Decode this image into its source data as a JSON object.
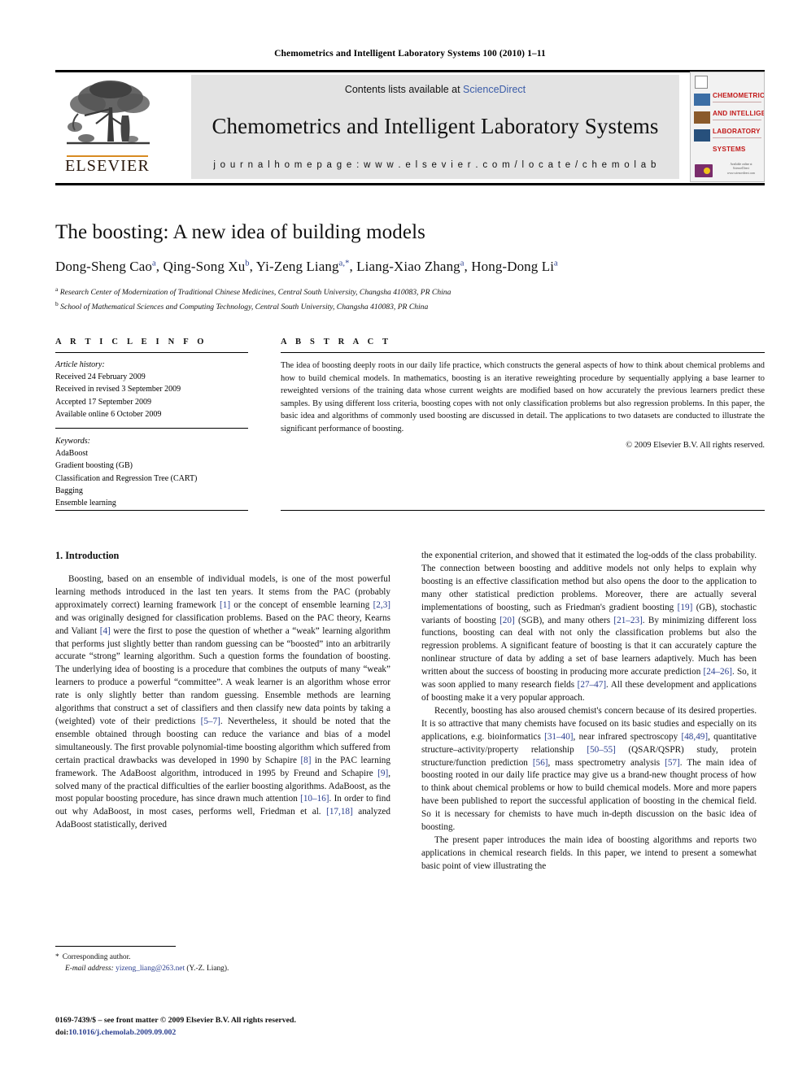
{
  "running_head": "Chemometrics and Intelligent Laboratory Systems 100 (2010) 1–11",
  "masthead": {
    "publisher_name": "ELSEVIER",
    "contents_prefix": "Contents lists available at ",
    "sciencedirect": "ScienceDirect",
    "journal_title": "Chemometrics and Intelligent Laboratory Systems",
    "homepage_label": "j o u r n a l   h o m e p a g e :   w w w . e l s e v i e r . c o m / l o c a t e / c h e m o l a b",
    "cover": {
      "line1": "CHEMOMETRICS",
      "line2": "AND INTELLIGENT",
      "line3": "LABORATORY",
      "line4": "SYSTEMS",
      "footer1": "Available online at",
      "footer2": "ScienceDirect",
      "footer3": "www.sciencedirect.com"
    }
  },
  "article": {
    "title": "The boosting: A new idea of building models",
    "authors_html": "Dong-Sheng Cao, Qing-Song Xu, Yi-Zeng Liang, Liang-Xiao Zhang, Hong-Dong Li",
    "affiliation_a": "Research Center of Modernization of Traditional Chinese Medicines, Central South University, Changsha 410083, PR China",
    "affiliation_b": "School of Mathematical Sciences and Computing Technology, Central South University, Changsha 410083, PR China"
  },
  "info": {
    "heading": "A R T I C L E   I N F O",
    "history_label": "Article history:",
    "history": [
      "Received 24 February 2009",
      "Received in revised 3 September 2009",
      "Accepted 17 September 2009",
      "Available online 6 October 2009"
    ],
    "keywords_label": "Keywords:",
    "keywords": [
      "AdaBoost",
      "Gradient boosting (GB)",
      "Classification and Regression Tree (CART)",
      "Bagging",
      "Ensemble learning"
    ]
  },
  "abstract": {
    "heading": "A B S T R A C T",
    "text": "The idea of boosting deeply roots in our daily life practice, which constructs the general aspects of how to think about chemical problems and how to build chemical models. In mathematics, boosting is an iterative reweighting procedure by sequentially applying a base learner to reweighted versions of the training data whose current weights are modified based on how accurately the previous learners predict these samples. By using different loss criteria, boosting copes with not only classification problems but also regression problems. In this paper, the basic idea and algorithms of commonly used boosting are discussed in detail. The applications to two datasets are conducted to illustrate the significant performance of boosting.",
    "copyright": "© 2009 Elsevier B.V. All rights reserved."
  },
  "body": {
    "section_title": "1. Introduction",
    "left_paragraph_1_part1": "Boosting, based on an ensemble of individual models, is one of the most powerful learning methods introduced in the last ten years. It stems from the PAC (probably approximately correct) learning framework ",
    "ref1": "[1]",
    "left_paragraph_1_part2": " or the concept of ensemble learning ",
    "ref23": "[2,3]",
    "left_paragraph_1_part3": " and was originally designed for classification problems. Based on the PAC theory, Kearns and Valiant ",
    "ref4": "[4]",
    "left_paragraph_1_part4": " were the first to pose the question of whether a “weak” learning algorithm that performs just slightly better than random guessing can be “boosted” into an arbitrarily accurate “strong” learning algorithm. Such a question forms the foundation of boosting. The underlying idea of boosting is a procedure that combines the outputs of many “weak” learners to produce a powerful “committee”. A weak learner is an algorithm whose error rate is only slightly better than random guessing. Ensemble methods are learning algorithms that construct a set of classifiers and then classify new data points by taking a (weighted) vote of their predictions ",
    "ref57": "[5–7]",
    "left_paragraph_1_part5": ". Nevertheless, it should be noted that the ensemble obtained through boosting can reduce the variance and bias of a model simultaneously. The first provable polynomial-time boosting algorithm which suffered from certain practical drawbacks was developed in 1990 by Schapire ",
    "ref8": "[8]",
    "left_paragraph_1_part6": " in the PAC learning framework. The AdaBoost algorithm, introduced in 1995 by Freund and Schapire ",
    "ref9": "[9]",
    "left_paragraph_1_part7": ", solved many of the practical difficulties of the earlier boosting algorithms. AdaBoost, as the most popular boosting procedure, has since drawn much attention ",
    "ref1016": "[10–16]",
    "left_paragraph_1_part8": ". In order to find out why AdaBoost, in most cases, performs well, Friedman et al. ",
    "ref1718": "[17,18]",
    "left_paragraph_1_part9": " analyzed AdaBoost statistically, derived ",
    "right_paragraph_1_part1": "the exponential criterion, and showed that it estimated the log-odds of the class probability. The connection between boosting and additive models not only helps to explain why boosting is an effective classification method but also opens the door to the application to many other statistical prediction problems. Moreover, there are actually several implementations of boosting, such as Friedman's gradient boosting ",
    "ref19": "[19]",
    "right_paragraph_1_part2": " (GB), stochastic variants of boosting ",
    "ref20": "[20]",
    "right_paragraph_1_part3": " (SGB), and many others ",
    "ref2123": "[21–23]",
    "right_paragraph_1_part4": ". By minimizing different loss functions, boosting can deal with not only the classification problems but also the regression problems. A significant feature of boosting is that it can accurately capture the nonlinear structure of data by adding a set of base learners adaptively. Much has been written about the success of boosting in producing more accurate prediction ",
    "ref2426": "[24–26]",
    "right_paragraph_1_part5": ". So, it was soon applied to many research fields ",
    "ref2747": "[27–47]",
    "right_paragraph_1_part6": ". All these development and applications of boosting make it a very popular approach.",
    "right_paragraph_2_part1": "Recently, boosting has also aroused chemist's concern because of its desired properties. It is so attractive that many chemists have focused on its basic studies and especially on its applications, e.g. bioinformatics ",
    "ref3140": "[31–40]",
    "right_paragraph_2_part2": ", near infrared spectroscopy ",
    "ref4849": "[48,49]",
    "right_paragraph_2_part3": ", quantitative structure–activity/property relationship ",
    "ref5055": "[50–55]",
    "right_paragraph_2_part4": " (QSAR/QSPR) study, protein structure/function prediction ",
    "ref56": "[56]",
    "right_paragraph_2_part5": ", mass spectrometry analysis ",
    "ref57b": "[57]",
    "right_paragraph_2_part6": ". The main idea of boosting rooted in our daily life practice may give us a brand-new thought process of how to think about chemical problems or how to build chemical models. More and more papers have been published to report the successful application of boosting in the chemical field. So it is necessary for chemists to have much in-depth discussion on the basic idea of boosting.",
    "right_paragraph_3": "The present paper introduces the main idea of boosting algorithms and reports two applications in chemical research fields. In this paper, we intend to present a somewhat basic point of view illustrating the"
  },
  "footnotes": {
    "corresponding": "Corresponding author.",
    "email_label": "E-mail address:",
    "email": "yizeng_liang@263.net",
    "email_suffix": "(Y.-Z. Liang)."
  },
  "imprint": {
    "line1": "0169-7439/$ – see front matter © 2009 Elsevier B.V. All rights reserved.",
    "doi_label": "doi:",
    "doi_value": "10.1016/j.chemolab.2009.09.002"
  },
  "colors": {
    "link": "#2b3f8f",
    "sciencedirect": "#3b5ca8",
    "panel": "#e3e3e3",
    "cover_red": "#c21a1a",
    "elsevier_orange": "#d88b22"
  }
}
